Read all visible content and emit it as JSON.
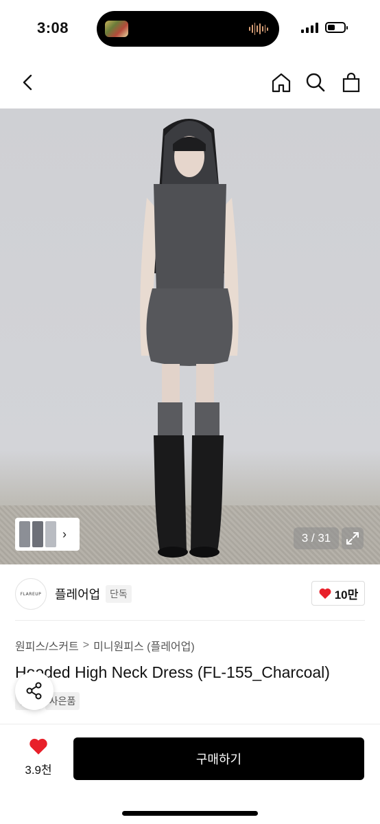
{
  "status_bar": {
    "time": "3:08",
    "battery_level": 0.45,
    "signal_bars": 4
  },
  "nav": {
    "back_icon": "chevron-left-icon",
    "home_icon": "home-icon",
    "search_icon": "search-icon",
    "bag_icon": "shopping-bag-icon"
  },
  "gallery": {
    "counter": "3 / 31",
    "expand_icon": "expand-icon",
    "thumb_chevron": "›"
  },
  "brand": {
    "logo_text": "FLAREUP",
    "name": "플레어업",
    "tag": "단독",
    "likes": "10만"
  },
  "product": {
    "breadcrumb": [
      "원피스/스커트",
      "미니원피스 (플레어업)"
    ],
    "breadcrumb_separator": ">",
    "title": "Hooded High Neck Dress (FL-155_Charcoal)",
    "tags": [
      "단독",
      "사은품"
    ]
  },
  "bottom_bar": {
    "wish_count": "3.9천",
    "buy_label": "구매하기"
  },
  "colors": {
    "heart": "#e8202a",
    "buy_button": "#000000",
    "background": "#ffffff"
  }
}
